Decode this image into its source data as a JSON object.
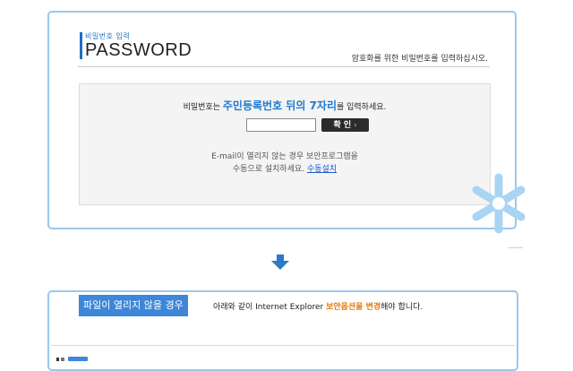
{
  "password_panel": {
    "subtitle": "비밀번호 입력",
    "title": "PASSWORD",
    "hint": "암호화를 위한 비밀번호를 입력하십시오.",
    "instruction_prefix": "비밀번호는 ",
    "instruction_highlight": "주민등록번호 뒤의 7자리",
    "instruction_suffix": "를 입력하세요.",
    "input_value": "",
    "confirm_label": "확 인",
    "confirm_arrow": "›",
    "note_line1": "E-mail이 열리지 않는 경우 보안프로그램을",
    "note_line2": "수동으로 설치하세요.",
    "manual_install_link": "수동설치"
  },
  "security_option_panel": {
    "label": "파일이 열리지 않을 경우",
    "text_prefix": "아래와 같이 Internet Explorer ",
    "text_highlight": "보안옵션을 변경",
    "text_suffix": "해야 합니다."
  },
  "colors": {
    "border": "#9cc7ea",
    "accent_blue": "#1c7ad2",
    "label_bg": "#3d86d8",
    "orange": "#e07a0e",
    "button_bg": "#2b2b2b"
  },
  "icons": {
    "decor": "asterisk-icon",
    "flow": "down-arrow-icon"
  }
}
